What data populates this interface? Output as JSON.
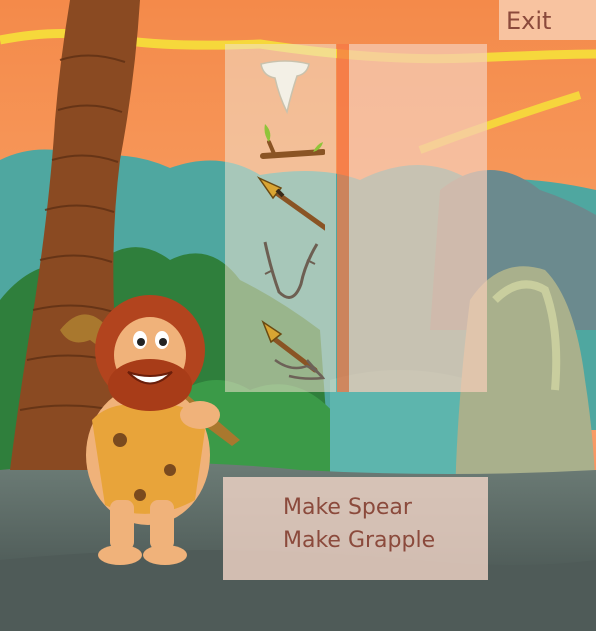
{
  "exit_label": "Exit",
  "inventory": {
    "items": [
      {
        "name": "tooth"
      },
      {
        "name": "stick"
      },
      {
        "name": "spear"
      },
      {
        "name": "vine"
      },
      {
        "name": "grapple"
      }
    ]
  },
  "craft_menu": {
    "options": [
      "Make Spear",
      "Make Grapple"
    ]
  }
}
